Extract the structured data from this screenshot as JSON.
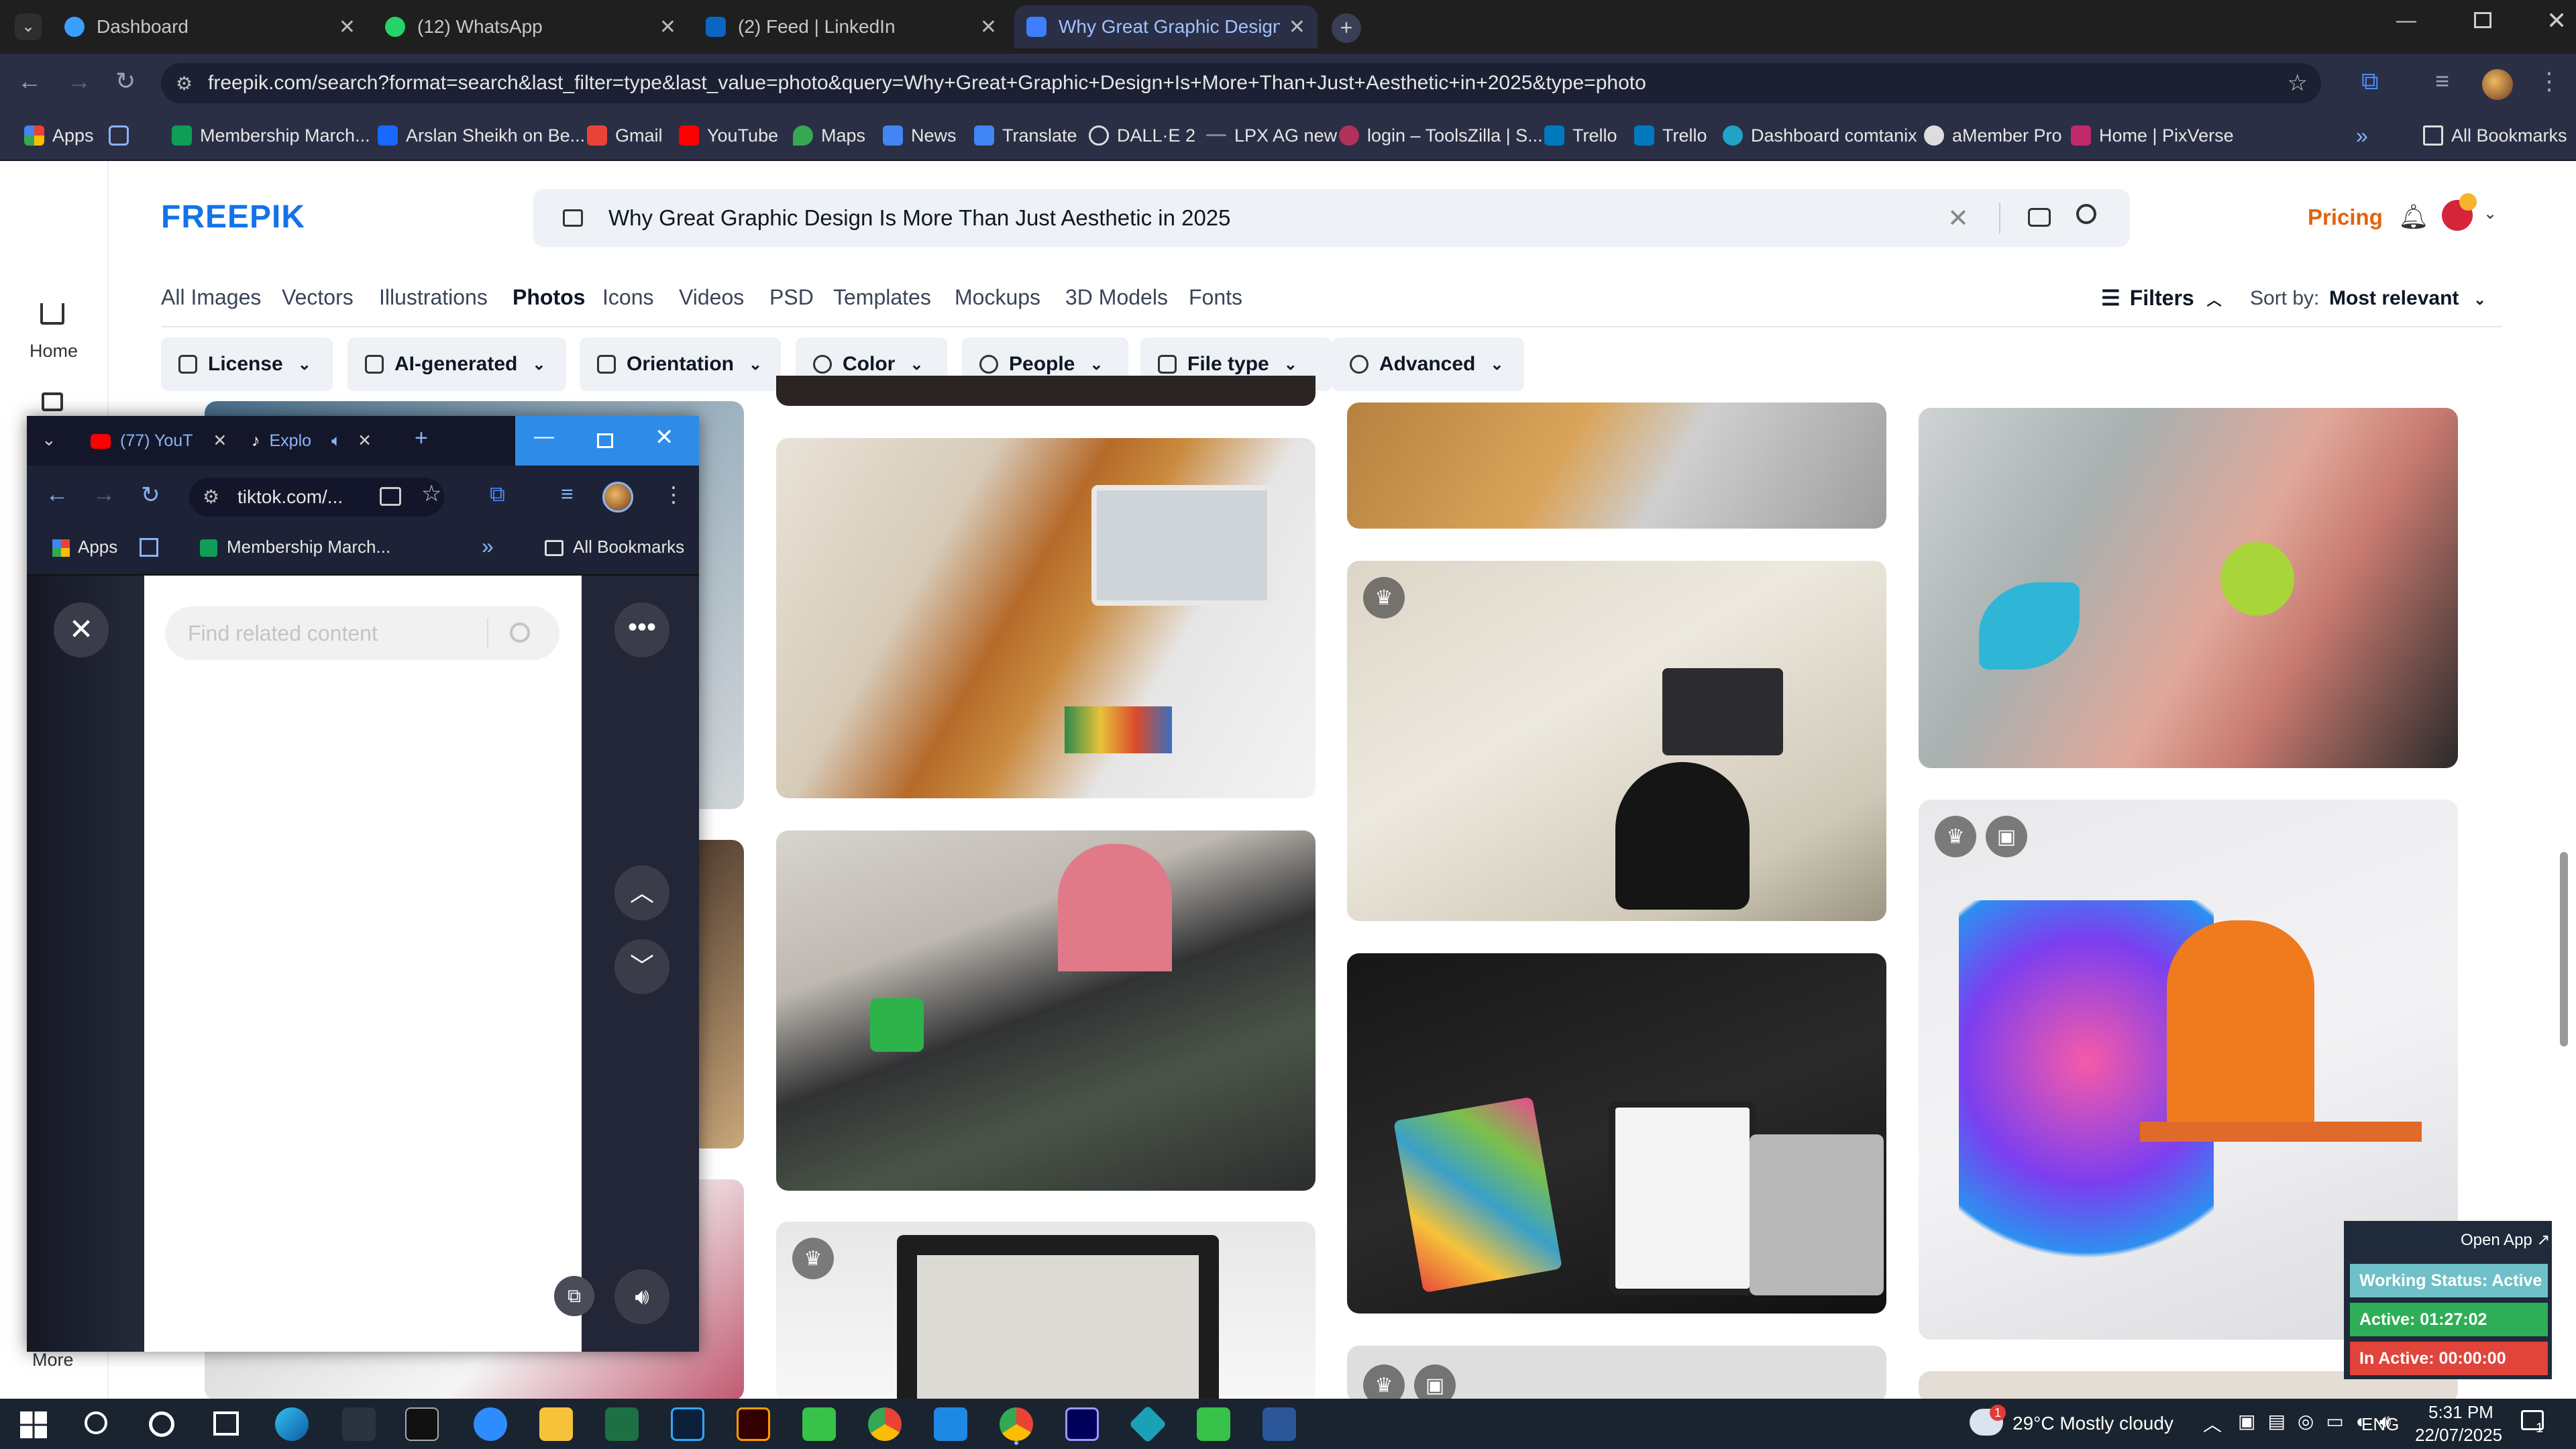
{
  "tabs": [
    {
      "label": "Dashboard",
      "color": "#3aa0ff"
    },
    {
      "label": "(12) WhatsApp",
      "color": "#25d366"
    },
    {
      "label": "(2) Feed | LinkedIn",
      "color": "#0a66c2"
    },
    {
      "label": "Why Great Graphic Design Is M",
      "color": "#3d7fff"
    }
  ],
  "address": {
    "url": "freepik.com/search?format=search&last_filter=type&last_value=photo&query=Why+Great+Graphic+Design+Is+More+Than+Just+Aesthetic+in+2025&type=photo"
  },
  "bookmarks": {
    "items": [
      "Apps",
      "Membership March...",
      "Arslan Sheikh on Be...",
      "Gmail",
      "YouTube",
      "Maps",
      "News",
      "Translate",
      "DALL·E 2",
      "LPX AG new",
      "login – ToolsZilla | S...",
      "Trello",
      "Trello",
      "Dashboard comtanix",
      "aMember Pro",
      "Home | PixVerse"
    ],
    "all": "All Bookmarks"
  },
  "freepik": {
    "logo": "FREEPIK",
    "search_value": "Why Great Graphic Design Is More Than Just Aesthetic in 2025",
    "pricing": "Pricing",
    "home": "Home",
    "more": "More",
    "categories": [
      "All Images",
      "Vectors",
      "Illustrations",
      "Photos",
      "Icons",
      "Videos",
      "PSD",
      "Templates",
      "Mockups",
      "3D Models",
      "Fonts"
    ],
    "filters_label": "Filters",
    "sort_label": "Sort by:",
    "sort_value": "Most relevant",
    "chips": [
      "License",
      "AI-generated",
      "Orientation",
      "Color",
      "People",
      "File type",
      "Advanced"
    ]
  },
  "popup": {
    "tabs": [
      "(77) YouT",
      "Explo"
    ],
    "url": "tiktok.com/...",
    "bookmarks": [
      "Apps",
      "Membership March...",
      "All Bookmarks"
    ],
    "search_placeholder": "Find related content"
  },
  "widget": {
    "open_app": "Open App ↗",
    "status": "Working Status: Active",
    "active": "Active: 01:27:02",
    "inactive": "In Active: 00:00:00"
  },
  "taskbar": {
    "weather": "29°C  Mostly cloudy",
    "lang": "ENG",
    "time": "5:31 PM",
    "date": "22/07/2025",
    "notifications": "1"
  }
}
